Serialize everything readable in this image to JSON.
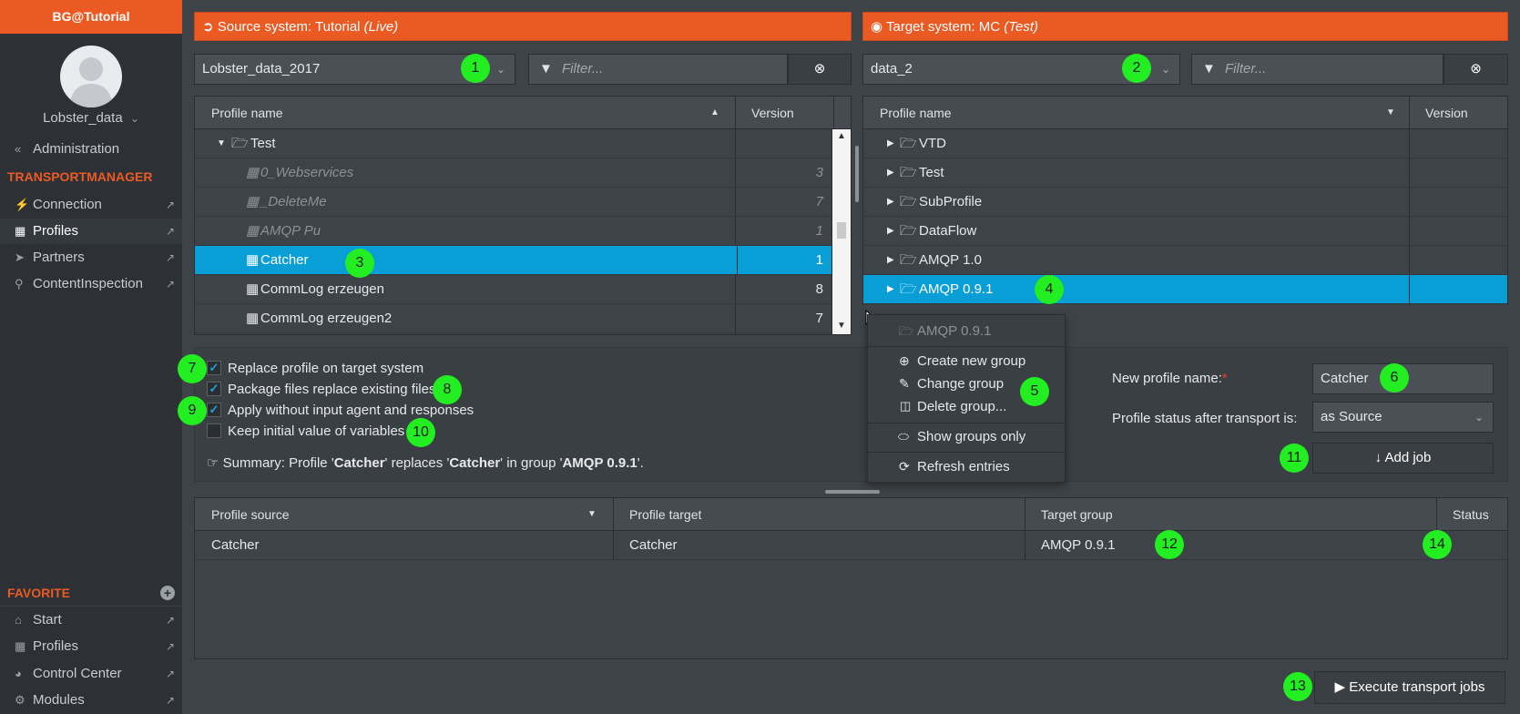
{
  "sidebar": {
    "brand": "BG@Tutorial",
    "username": "Lobster_data",
    "admin_label": "Administration",
    "section_transport": "TRANSPORTMANAGER",
    "items": [
      {
        "label": "Connection"
      },
      {
        "label": "Profiles"
      },
      {
        "label": "Partners"
      },
      {
        "label": "ContentInspection"
      }
    ],
    "section_favorite": "FAVORITE",
    "favorites": [
      {
        "label": "Start"
      },
      {
        "label": "Profiles"
      },
      {
        "label": "Control Center"
      },
      {
        "label": "Modules"
      }
    ]
  },
  "source": {
    "prefix": "Source system:",
    "name": "Tutorial",
    "mode": "(Live)",
    "dataset": "Lobster_data_2017",
    "filter_placeholder": "Filter...",
    "columns": {
      "name": "Profile name",
      "version": "Version"
    },
    "rows": [
      {
        "name": "Test",
        "version": ""
      },
      {
        "name": "0_Webservices",
        "version": "3"
      },
      {
        "name": "_DeleteMe",
        "version": "7"
      },
      {
        "name": "AMQP Pu",
        "version": "1"
      },
      {
        "name": "Catcher",
        "version": "1"
      },
      {
        "name": "CommLog erzeugen",
        "version": "8"
      },
      {
        "name": "CommLog erzeugen2",
        "version": "7"
      }
    ]
  },
  "target": {
    "prefix": "Target system:",
    "name": "MC",
    "mode": "(Test)",
    "dataset": "data_2",
    "filter_placeholder": "Filter...",
    "columns": {
      "name": "Profile name",
      "version": "Version"
    },
    "rows": [
      {
        "name": "VTD"
      },
      {
        "name": "Test"
      },
      {
        "name": "SubProfile"
      },
      {
        "name": "DataFlow"
      },
      {
        "name": "AMQP 1.0"
      },
      {
        "name": "AMQP 0.9.1"
      }
    ]
  },
  "context_menu": {
    "header": "AMQP 0.9.1",
    "items": [
      "Create new group",
      "Change group",
      "Delete group...",
      "Show groups only",
      "Refresh entries"
    ]
  },
  "options": {
    "replace_profile": {
      "label": "Replace profile on target system",
      "checked": true
    },
    "package_files": {
      "label": "Package files replace existing files",
      "checked": true
    },
    "apply_without": {
      "label": "Apply without input agent and responses",
      "checked": true
    },
    "keep_initial": {
      "label": "Keep initial value of variables",
      "checked": false
    }
  },
  "summary": {
    "prefix": "Summary: Profile '",
    "source": "Catcher",
    "mid": "' replaces '",
    "target": "Catcher",
    "mid2": "' in group '",
    "group": "AMQP 0.9.1",
    "suffix": "'."
  },
  "form": {
    "new_name_label": "New profile name:",
    "required_mark": "*",
    "new_name_value": "Catcher",
    "status_label": "Profile status after transport is:",
    "status_value": "as Source",
    "add_job": "Add job"
  },
  "jobs": {
    "columns": {
      "source": "Profile source",
      "target": "Profile target",
      "group": "Target group",
      "status": "Status"
    },
    "rows": [
      {
        "source": "Catcher",
        "target": "Catcher",
        "group": "AMQP 0.9.1",
        "status": ""
      }
    ]
  },
  "execute_label": "Execute transport jobs",
  "badges": [
    "1",
    "2",
    "3",
    "4",
    "5",
    "6",
    "7",
    "8",
    "9",
    "10",
    "11",
    "12",
    "13",
    "14"
  ],
  "colors": {
    "accent": "#ec5a24",
    "selection": "#0a9ed7",
    "badge": "#22ee22"
  }
}
